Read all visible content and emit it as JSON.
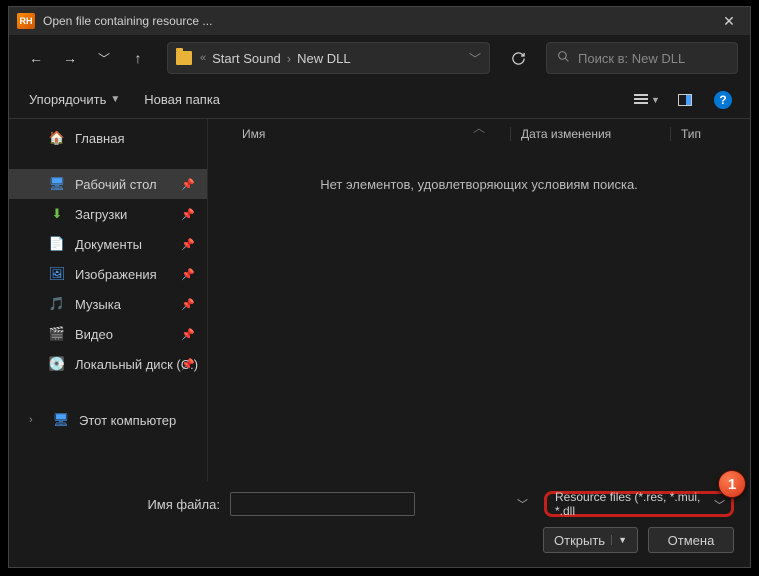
{
  "title": "Open file containing resource ...",
  "app_icon_text": "RH",
  "breadcrumb": {
    "parent": "Start Sound",
    "current": "New DLL"
  },
  "search_placeholder": "Поиск в: New DLL",
  "toolbar": {
    "organize": "Упорядочить",
    "new_folder": "Новая папка"
  },
  "sidebar": {
    "home": "Главная",
    "desktop": "Рабочий стол",
    "downloads": "Загрузки",
    "documents": "Документы",
    "pictures": "Изображения",
    "music": "Музыка",
    "video": "Видео",
    "local_disk": "Локальный диск (C:)",
    "this_pc": "Этот компьютер"
  },
  "columns": {
    "name": "Имя",
    "date": "Дата изменения",
    "type": "Тип"
  },
  "empty_message": "Нет элементов, удовлетворяющих условиям поиска.",
  "footer": {
    "filename_label": "Имя файла:",
    "filename_value": "",
    "filter": "Resource files (*.res, *.mui, *.dll",
    "open": "Открыть",
    "cancel": "Отмена"
  },
  "callout": "1"
}
